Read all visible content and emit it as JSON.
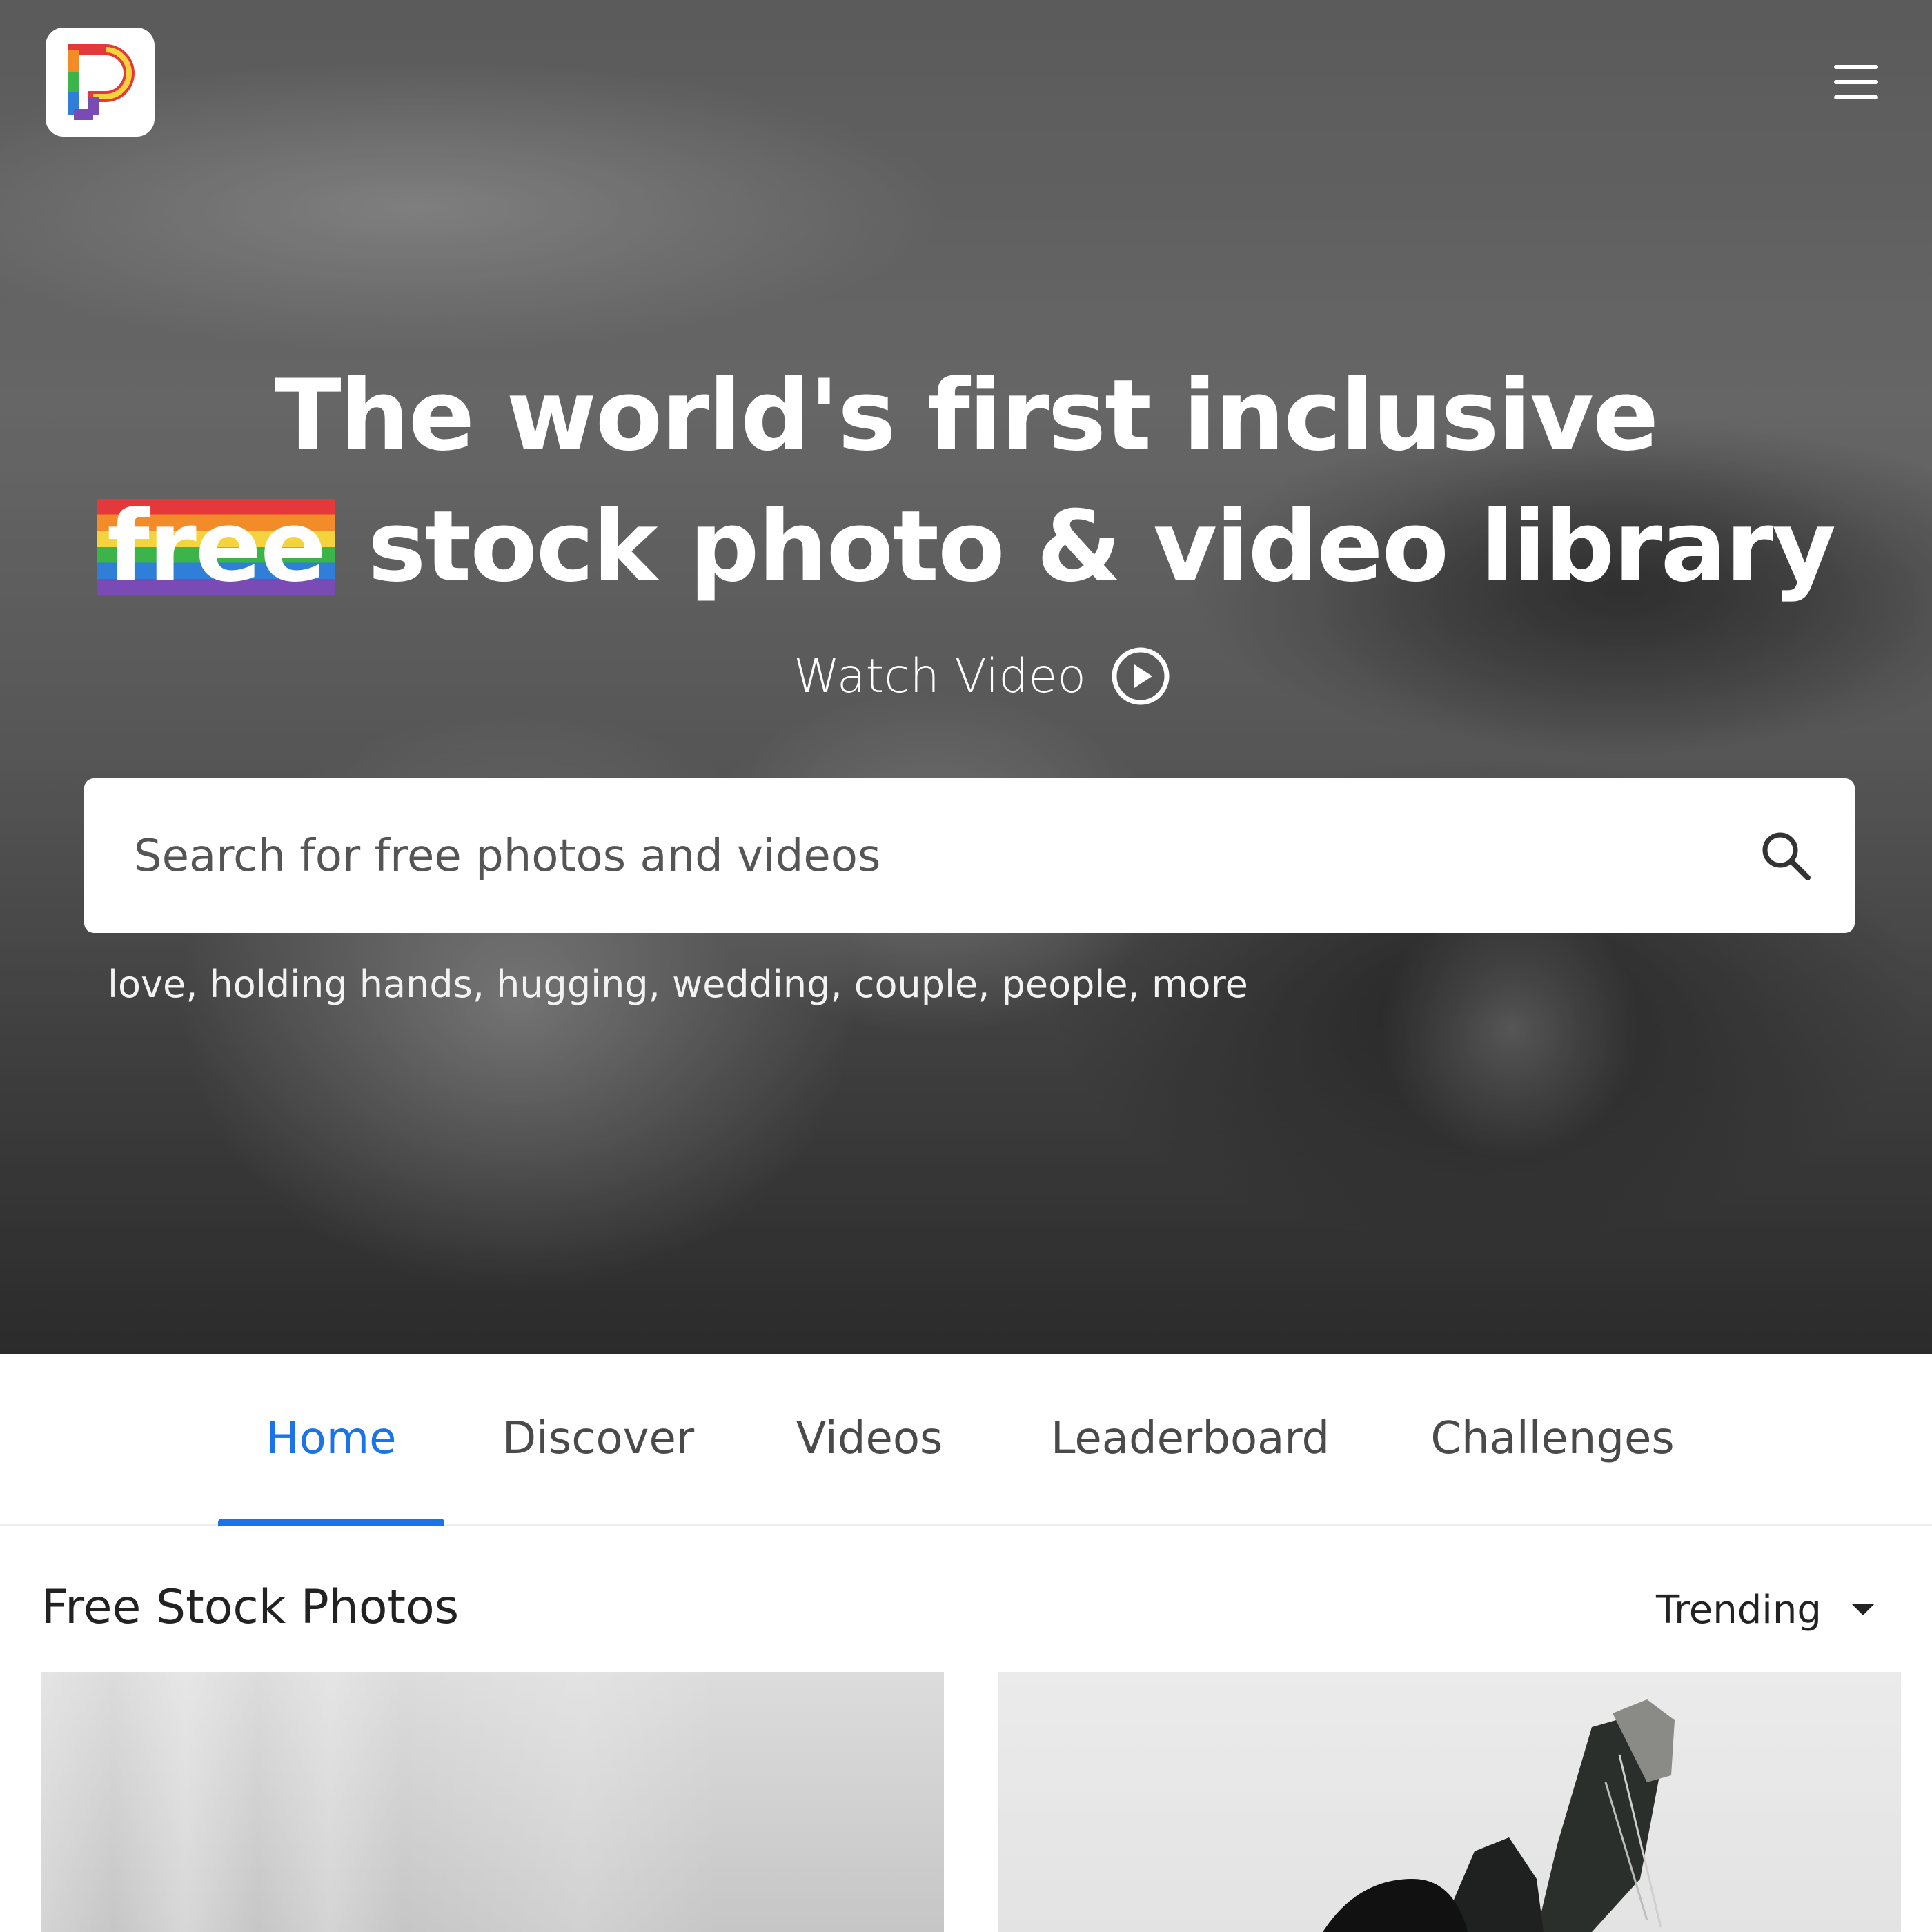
{
  "hero": {
    "headline_line1": "The world's first inclusive",
    "headline_free": "free",
    "headline_line2_rest": " stock photo & video library",
    "watch_video": "Watch Video",
    "search": {
      "placeholder": "Search for free photos and videos"
    },
    "suggestions": [
      "love",
      "holding hands",
      "hugging",
      "wedding",
      "couple",
      "people",
      "more"
    ],
    "suggestion_separator": ", "
  },
  "icons": {
    "logo": "rainbow-p-logo-icon",
    "menu": "hamburger-menu-icon",
    "play": "play-circle-icon",
    "search": "search-icon",
    "dropdown": "caret-down-icon"
  },
  "tabs": [
    {
      "label": "Home",
      "active": true
    },
    {
      "label": "Discover",
      "active": false
    },
    {
      "label": "Videos",
      "active": false
    },
    {
      "label": "Leaderboard",
      "active": false
    },
    {
      "label": "Challenges",
      "active": false
    }
  ],
  "content": {
    "section_title": "Free Stock Photos",
    "sort_value": "Trending"
  },
  "colors": {
    "accent": "#1a73e8",
    "tab_text": "#4a4a4a",
    "rainbow": [
      "#e5383b",
      "#f28c28",
      "#f5d33c",
      "#3bb54a",
      "#2f7fd8",
      "#7a4bb5"
    ]
  }
}
